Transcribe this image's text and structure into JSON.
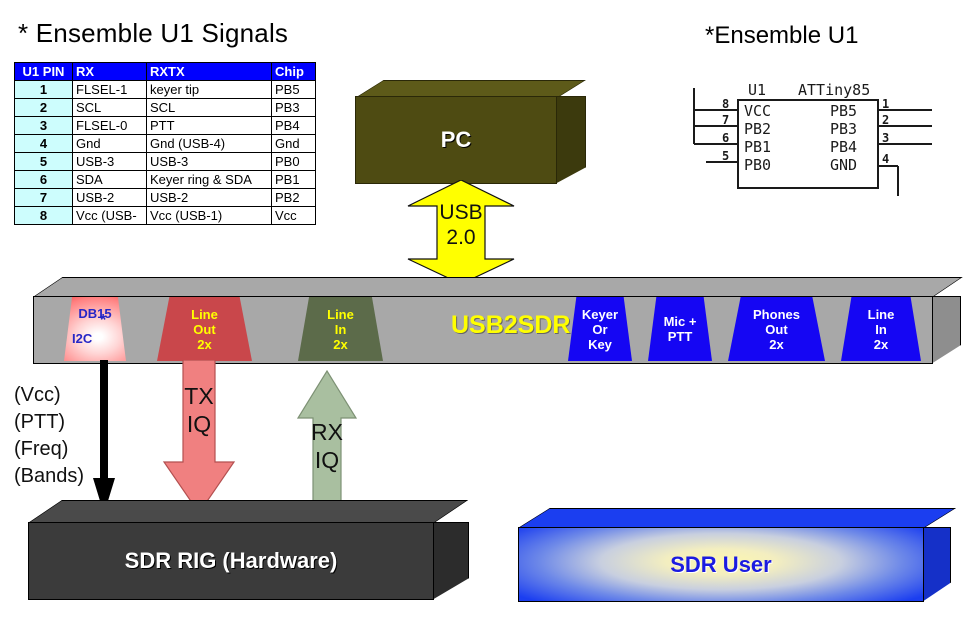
{
  "titles": {
    "left": "* Ensemble U1 Signals",
    "right": "*Ensemble U1"
  },
  "signal_table": {
    "headers": [
      "U1 PIN",
      "RX",
      "RXTX",
      "Chip"
    ],
    "rows": [
      [
        "1",
        "FLSEL-1",
        "keyer tip",
        "PB5"
      ],
      [
        "2",
        "SCL",
        "SCL",
        "PB3"
      ],
      [
        "3",
        "FLSEL-0",
        "PTT",
        "PB4"
      ],
      [
        "4",
        "Gnd",
        "Gnd (USB-4)",
        "Gnd"
      ],
      [
        "5",
        "USB-3",
        "USB-3",
        "PB0"
      ],
      [
        "6",
        "SDA",
        "Keyer ring & SDA",
        "PB1"
      ],
      [
        "7",
        "USB-2",
        "USB-2",
        "PB2"
      ],
      [
        "8",
        "Vcc (USB-",
        "Vcc (USB-1)",
        "Vcc"
      ]
    ],
    "header_bg": "#0000FF",
    "pin_cell_bg": "#CDFDFD"
  },
  "chip": {
    "ref": "U1",
    "part": "ATTiny85",
    "left_pins": [
      {
        "num": "8",
        "name": "VCC"
      },
      {
        "num": "7",
        "name": "PB2"
      },
      {
        "num": "6",
        "name": "PB1"
      },
      {
        "num": "5",
        "name": "PB0"
      }
    ],
    "right_pins": [
      {
        "num": "1",
        "name": "PB5"
      },
      {
        "num": "2",
        "name": "PB3"
      },
      {
        "num": "3",
        "name": "PB4"
      },
      {
        "num": "4",
        "name": "GND"
      }
    ]
  },
  "pc_box": {
    "label": "PC",
    "color": "#4E4B12"
  },
  "usb_arrow": {
    "line1": "USB",
    "line2": "2.0",
    "color": "#FFFF00"
  },
  "sdr_bar": {
    "label": "USB2SDR",
    "label_color": "#FFFF00",
    "body_color": "#A8A8A8",
    "connectors": [
      {
        "id": "db15",
        "line1": "DB15",
        "line2": "I2C",
        "star": "*",
        "color": "#EE2222",
        "text_color": "#2626C6"
      },
      {
        "id": "line-out",
        "line1": "Line",
        "line2": "Out",
        "line3": "2x",
        "color": "#C9474B",
        "text_color": "#FFFF00"
      },
      {
        "id": "line-in",
        "line1": "Line",
        "line2": "In",
        "line3": "2x",
        "color": "#5C6B4A",
        "text_color": "#FFFF00"
      },
      {
        "id": "keyer",
        "line1": "Keyer",
        "line2": "Or",
        "line3": "Key",
        "color": "#1506F3",
        "text_color": "#FFFFFF"
      },
      {
        "id": "mic-ptt",
        "line1": "Mic +",
        "line2": "PTT",
        "color": "#1506F3",
        "text_color": "#FFFFFF"
      },
      {
        "id": "phones-out",
        "line1": "Phones",
        "line2": "Out",
        "line3": "2x",
        "color": "#1506F3",
        "text_color": "#FFFFFF"
      },
      {
        "id": "line-in-2",
        "line1": "Line",
        "line2": "In",
        "line3": "2x",
        "color": "#1506F3",
        "text_color": "#FFFFFF"
      }
    ]
  },
  "arrows": {
    "tx": {
      "line1": "TX",
      "line2": "IQ",
      "color": "#F08080",
      "direction": "down"
    },
    "rx": {
      "line1": "RX",
      "line2": "IQ",
      "color": "#A9BFA0",
      "direction": "up"
    },
    "db15": {
      "color": "#000000",
      "direction": "down"
    }
  },
  "side_labels": [
    "(Vcc)",
    "(PTT)",
    "(Freq)",
    "(Bands)"
  ],
  "rig_box": {
    "label": "SDR RIG (Hardware)",
    "color": "#3B3B3B"
  },
  "user_box": {
    "label": "SDR User",
    "label_color": "#1B1BE0",
    "color": "#1B3EF0"
  }
}
